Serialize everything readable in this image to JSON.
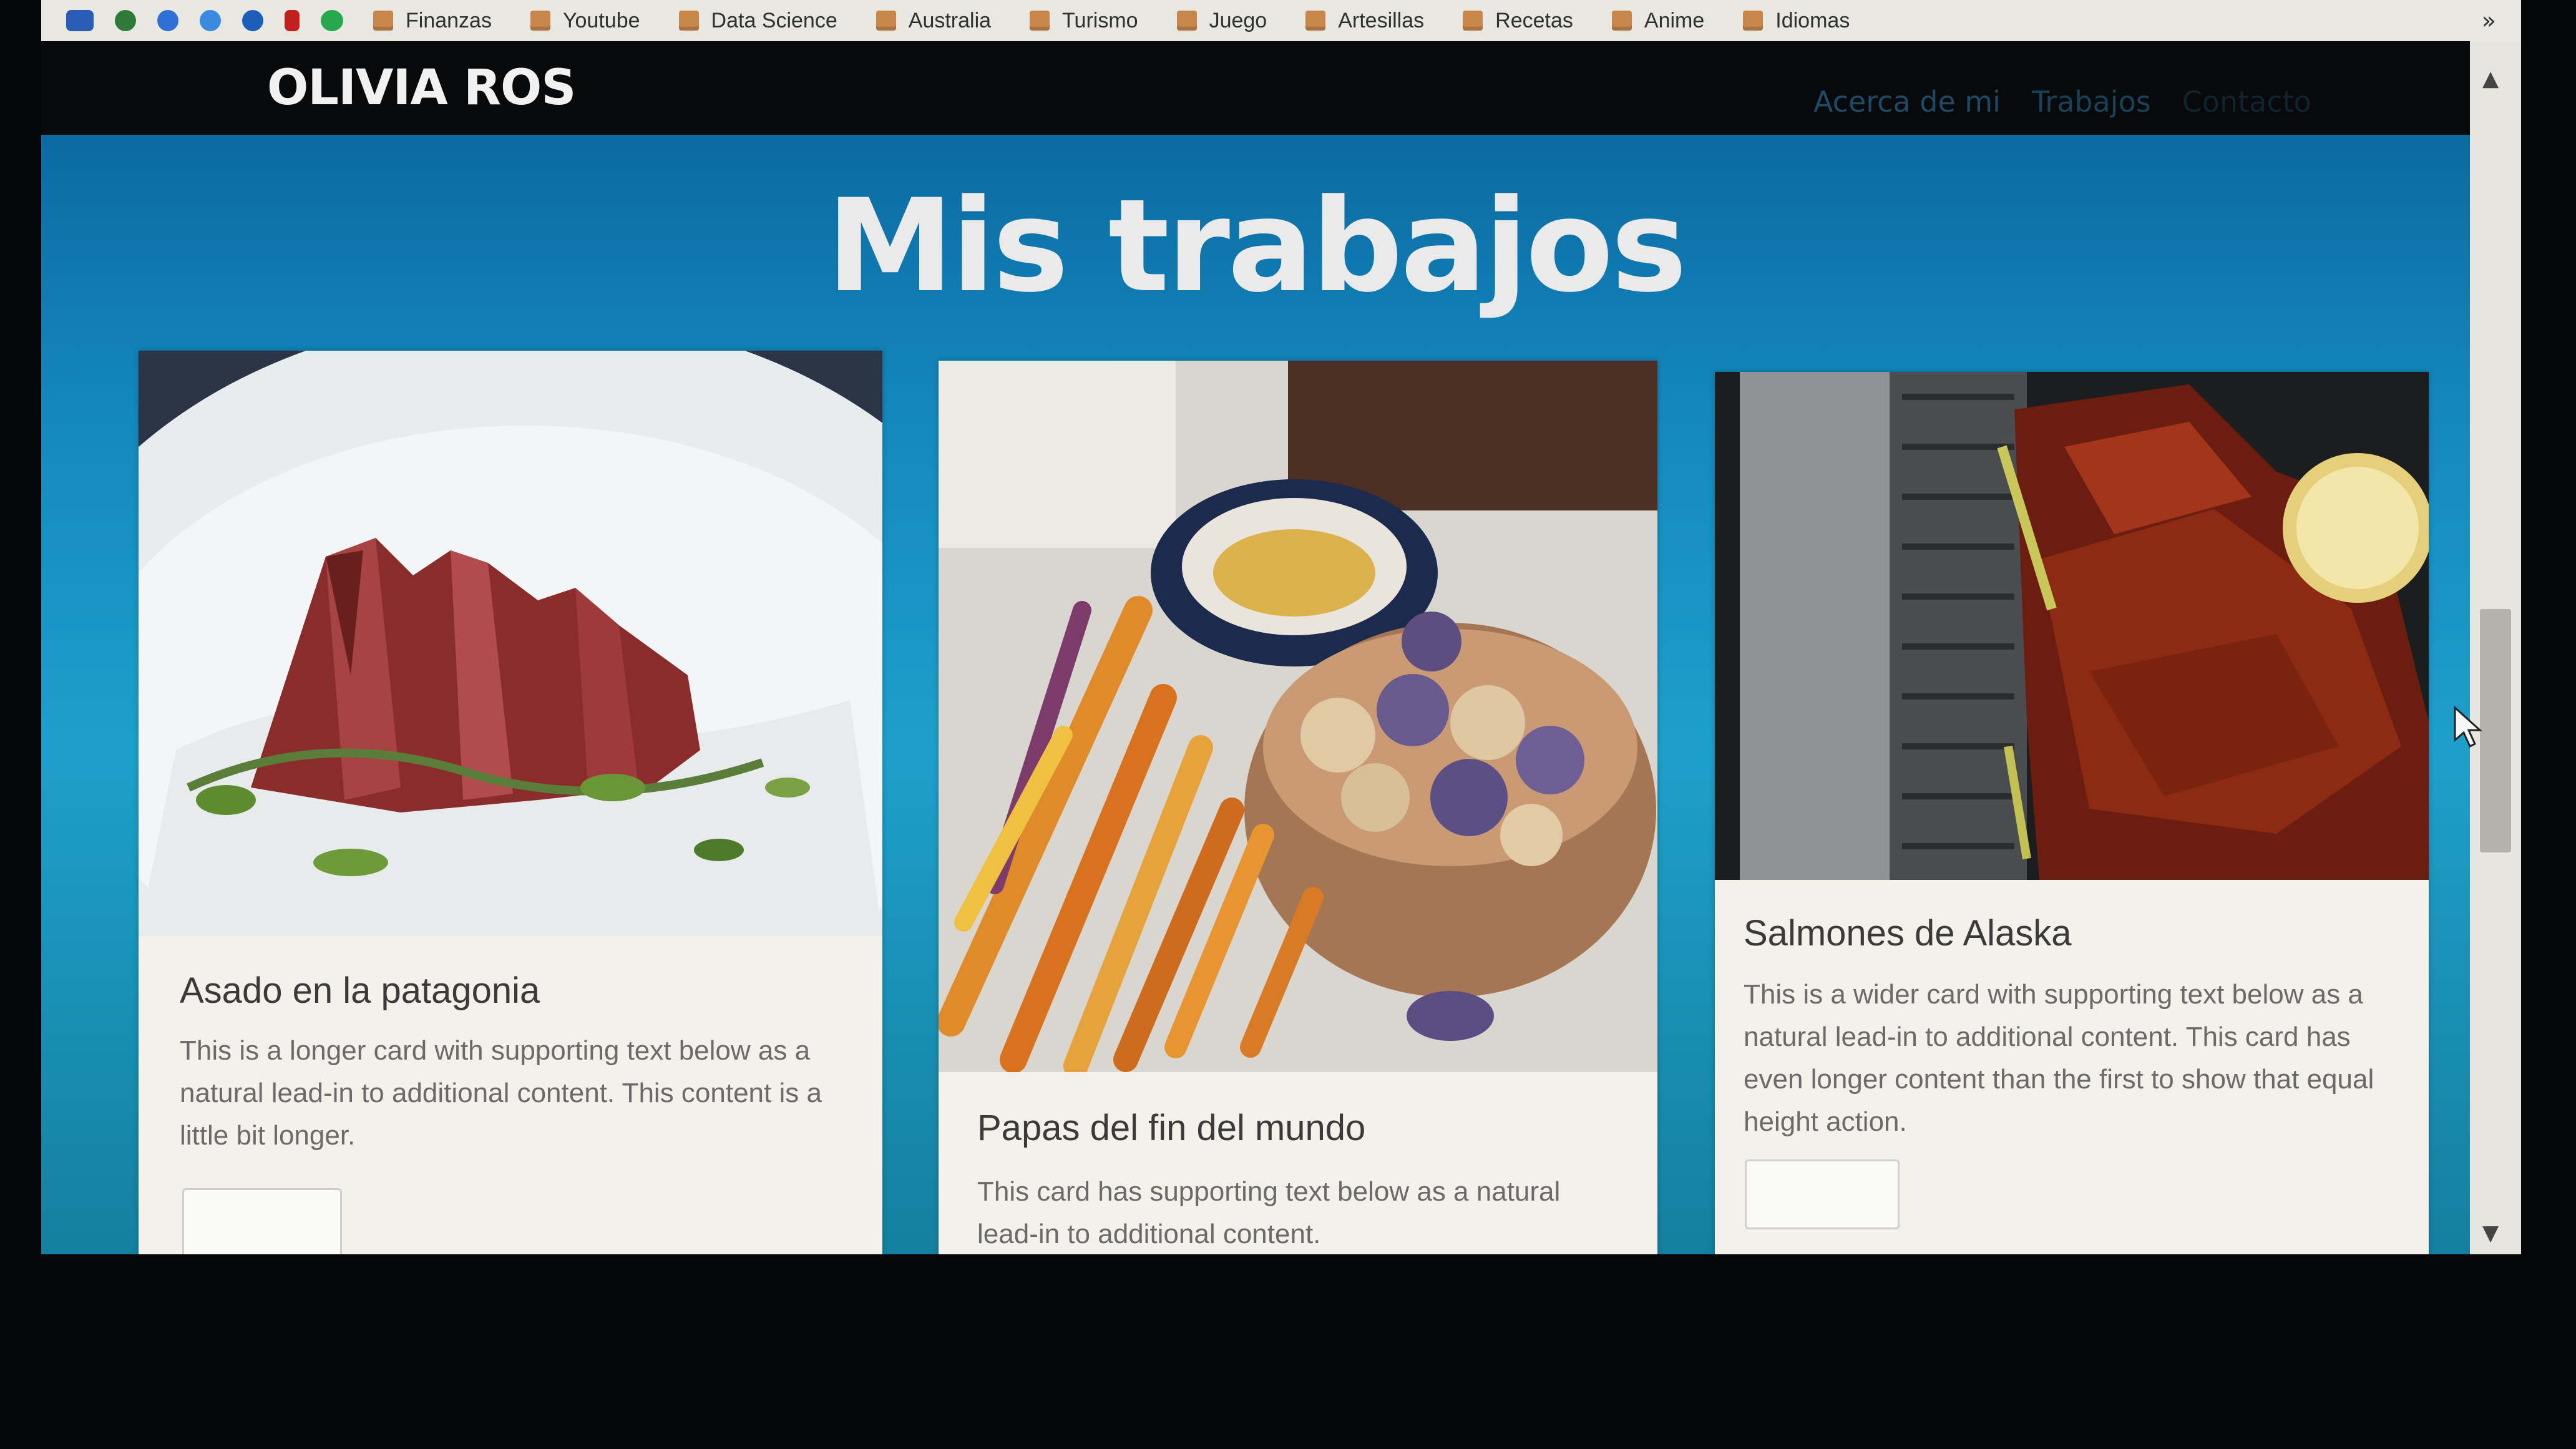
{
  "bookmarks": {
    "items": [
      {
        "label": "Finanzas"
      },
      {
        "label": "Youtube"
      },
      {
        "label": "Data Science"
      },
      {
        "label": "Australia"
      },
      {
        "label": "Turismo"
      },
      {
        "label": "Juego"
      },
      {
        "label": "Artesillas"
      },
      {
        "label": "Recetas"
      },
      {
        "label": "Anime"
      },
      {
        "label": "Idiomas"
      }
    ],
    "overflow": "»",
    "folder_color": "#c9864a"
  },
  "navbar": {
    "brand": "OLIVIA ROS",
    "links": [
      {
        "label": "Acerca de mi"
      },
      {
        "label": "Trabajos"
      },
      {
        "label": "Contacto"
      }
    ]
  },
  "hero": {
    "title": "Mis trabajos",
    "background_color": "#1488bd"
  },
  "cards": [
    {
      "title": "Asado en la patagonia",
      "text": "This is a longer card with supporting text below as a natural lead-in to additional content. This content is a little bit longer.",
      "image_icon": "steak-photo"
    },
    {
      "title": "Papas del fin del mundo",
      "text": "This card has supporting text below as a natural lead-in to additional content.",
      "image_icon": "vegetables-photo"
    },
    {
      "title": "Salmones de Alaska",
      "text": "This is a wider card with supporting text below as a natural lead-in to additional content. This card has even longer content than the first to show that equal height action.",
      "image_icon": "salmon-photo"
    }
  ],
  "scrollbar": {
    "up": "▲",
    "down": "▼"
  }
}
